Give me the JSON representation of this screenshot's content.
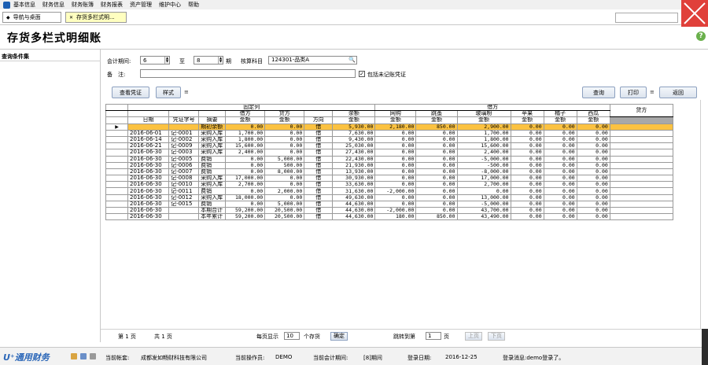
{
  "menu": [
    "基本信息",
    "财务信息",
    "财务账簿",
    "财务报表",
    "资产管理",
    "维护中心",
    "帮助"
  ],
  "tabs": [
    {
      "label": "导航与桌面",
      "mark": "◆"
    },
    {
      "label": "存货多栏式明...",
      "mark": "✕"
    }
  ],
  "page_title": "存货多栏式明细账",
  "help_icon": "?",
  "left_panel": {
    "title": "查询条件集"
  },
  "filters": {
    "period_label": "会计期间:",
    "period_from": "6",
    "to_label": "至",
    "period_to": "8",
    "period_suffix": "期",
    "subject_label": "核算科目",
    "subject_value": "124301-品类A",
    "remark_label": "备　注:",
    "remark_value": "",
    "include_label": "包括未记账凭证",
    "include_checked": "✓"
  },
  "buttons": {
    "view_voucher": "查看凭证",
    "style": "样式",
    "query": "查询",
    "print": "打印",
    "back": "返回",
    "split": "≡"
  },
  "grid": {
    "group_fixed": "固定列",
    "group_debit": "借方",
    "group_credit": "贷方",
    "h2": {
      "debit": "借方",
      "credit": "贷方",
      "balance": "余额",
      "c1": "网购",
      "c2": "跳蚤",
      "c3": "玻璃粉",
      "c4": "苹果",
      "c5": "橘子",
      "c6": "西瓜"
    },
    "h3": {
      "date": "日期",
      "voucher": "凭证字号",
      "summary": "摘要",
      "amount": "金额",
      "direction": "方向"
    },
    "indicator": "▶",
    "rows": [
      {
        "date": "",
        "voucher": "",
        "summary": "期初余额",
        "debit": "0.00",
        "credit": "0.00",
        "dir": "借",
        "balance": "5,930.00",
        "c1": "2,180.00",
        "c2": "850.00",
        "c3": "2,900.00",
        "c4": "0.00",
        "c5": "0.00",
        "c6": "0.00",
        "opening": true
      },
      {
        "date": "2016-06-01",
        "voucher": "记-0001",
        "summary": "采购入库",
        "debit": "1,700.00",
        "credit": "0.00",
        "dir": "借",
        "balance": "7,630.00",
        "c1": "0.00",
        "c2": "0.00",
        "c3": "1,700.00",
        "c4": "0.00",
        "c5": "0.00",
        "c6": "0.00"
      },
      {
        "date": "2016-06-14",
        "voucher": "记-0002",
        "summary": "采购入库",
        "debit": "1,800.00",
        "credit": "0.00",
        "dir": "借",
        "balance": "9,430.00",
        "c1": "0.00",
        "c2": "0.00",
        "c3": "1,800.00",
        "c4": "0.00",
        "c5": "0.00",
        "c6": "0.00"
      },
      {
        "date": "2016-06-21",
        "voucher": "记-0009",
        "summary": "采购入库",
        "debit": "15,600.00",
        "credit": "0.00",
        "dir": "借",
        "balance": "25,030.00",
        "c1": "0.00",
        "c2": "0.00",
        "c3": "15,600.00",
        "c4": "0.00",
        "c5": "0.00",
        "c6": "0.00"
      },
      {
        "date": "2016-06-30",
        "voucher": "记-0003",
        "summary": "采购入库",
        "debit": "2,400.00",
        "credit": "0.00",
        "dir": "借",
        "balance": "27,430.00",
        "c1": "0.00",
        "c2": "0.00",
        "c3": "2,400.00",
        "c4": "0.00",
        "c5": "0.00",
        "c6": "0.00"
      },
      {
        "date": "2016-06-30",
        "voucher": "记-0005",
        "summary": "费销",
        "debit": "0.00",
        "credit": "5,000.00",
        "dir": "借",
        "balance": "22,430.00",
        "c1": "0.00",
        "c2": "0.00",
        "c3": "-5,000.00",
        "c4": "0.00",
        "c5": "0.00",
        "c6": "0.00"
      },
      {
        "date": "2016-06-30",
        "voucher": "记-0006",
        "summary": "费销",
        "debit": "0.00",
        "credit": "500.00",
        "dir": "借",
        "balance": "21,930.00",
        "c1": "0.00",
        "c2": "0.00",
        "c3": "-500.00",
        "c4": "0.00",
        "c5": "0.00",
        "c6": "0.00"
      },
      {
        "date": "2016-06-30",
        "voucher": "记-0007",
        "summary": "费销",
        "debit": "0.00",
        "credit": "8,000.00",
        "dir": "借",
        "balance": "13,930.00",
        "c1": "0.00",
        "c2": "0.00",
        "c3": "-8,000.00",
        "c4": "0.00",
        "c5": "0.00",
        "c6": "0.00"
      },
      {
        "date": "2016-06-30",
        "voucher": "记-0008",
        "summary": "采购入库",
        "debit": "17,000.00",
        "credit": "0.00",
        "dir": "借",
        "balance": "30,930.00",
        "c1": "0.00",
        "c2": "0.00",
        "c3": "17,000.00",
        "c4": "0.00",
        "c5": "0.00",
        "c6": "0.00"
      },
      {
        "date": "2016-06-30",
        "voucher": "记-0010",
        "summary": "采购入库",
        "debit": "2,700.00",
        "credit": "0.00",
        "dir": "借",
        "balance": "33,630.00",
        "c1": "0.00",
        "c2": "0.00",
        "c3": "2,700.00",
        "c4": "0.00",
        "c5": "0.00",
        "c6": "0.00"
      },
      {
        "date": "2016-06-30",
        "voucher": "记-0011",
        "summary": "费销",
        "debit": "0.00",
        "credit": "2,000.00",
        "dir": "借",
        "balance": "31,630.00",
        "c1": "-2,000.00",
        "c2": "0.00",
        "c3": "0.00",
        "c4": "0.00",
        "c5": "0.00",
        "c6": "0.00"
      },
      {
        "date": "2016-06-30",
        "voucher": "记-0012",
        "summary": "采购入库",
        "debit": "18,000.00",
        "credit": "0.00",
        "dir": "借",
        "balance": "49,630.00",
        "c1": "0.00",
        "c2": "0.00",
        "c3": "13,000.00",
        "c4": "0.00",
        "c5": "0.00",
        "c6": "0.00"
      },
      {
        "date": "2016-06-30",
        "voucher": "记-0015",
        "summary": "费销",
        "debit": "0.00",
        "credit": "5,000.00",
        "dir": "借",
        "balance": "44,630.00",
        "c1": "0.00",
        "c2": "0.00",
        "c3": "-5,000.00",
        "c4": "0.00",
        "c5": "0.00",
        "c6": "0.00"
      },
      {
        "date": "2016-06-30",
        "voucher": "",
        "summary": "本期合计",
        "debit": "59,200.00",
        "credit": "20,500.00",
        "dir": "借",
        "balance": "44,630.00",
        "c1": "-2,000.00",
        "c2": "0.00",
        "c3": "43,700.00",
        "c4": "0.00",
        "c5": "0.00",
        "c6": "0.00"
      },
      {
        "date": "2016-06-30",
        "voucher": "",
        "summary": "本年累计",
        "debit": "59,200.00",
        "credit": "20,500.00",
        "dir": "借",
        "balance": "44,630.00",
        "c1": "180.00",
        "c2": "850.00",
        "c3": "43,490.00",
        "c4": "0.00",
        "c5": "0.00",
        "c6": "0.00"
      }
    ]
  },
  "pager": {
    "page_label": "第 1 页",
    "total_label": "共 1 页",
    "per_page_label": "每页显示",
    "per_page_value": "10",
    "per_page_suffix": "个存货",
    "confirm": "确定",
    "goto_label": "跳转到第",
    "goto_value": "1",
    "goto_suffix": "页",
    "prev": "上页",
    "next": "下页"
  },
  "status": {
    "brand": "U⁺通用财务",
    "account_label": "当前帐套:",
    "account_value": "成都发如畅财科技有限公司",
    "operator_label": "当前操作员:",
    "operator_value": "DEMO",
    "period_label": "当前会计期间:",
    "period_value": "[8]期间",
    "login_label": "登录日期:",
    "login_value": "2016-12-25",
    "message": "登录消息:demo登录了。"
  }
}
